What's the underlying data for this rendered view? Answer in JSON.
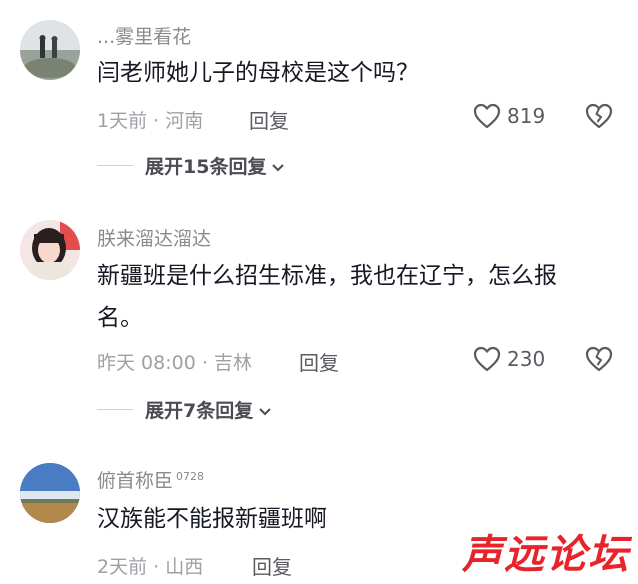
{
  "comments": [
    {
      "username": "...雾里看花",
      "badge": "",
      "text": "闫老师她儿子的母校是这个吗？",
      "meta": "1天前 · 河南",
      "reply_label": "回复",
      "likes": "819",
      "expand_label": "展开15条回复"
    },
    {
      "username": "朕来溜达溜达",
      "badge": "",
      "text": "新疆班是什么招生标准，我也在辽宁，怎么报名。",
      "meta": "昨天 08:00 · 吉林",
      "reply_label": "回复",
      "likes": "230",
      "expand_label": "展开7条回复"
    },
    {
      "username": "俯首称臣",
      "badge": "0728",
      "text": "汉族能不能报新疆班啊",
      "meta": "2天前 · 山西",
      "reply_label": "回复",
      "likes": "",
      "expand_label": ""
    }
  ],
  "watermark": "声远论坛",
  "icons": {
    "like": "heart-outline-icon",
    "dislike": "broken-heart-icon",
    "expand": "chevron-down-icon"
  },
  "colors": {
    "text": "#161823",
    "secondary": "#8a8b91",
    "watermark": "#e8242b"
  }
}
